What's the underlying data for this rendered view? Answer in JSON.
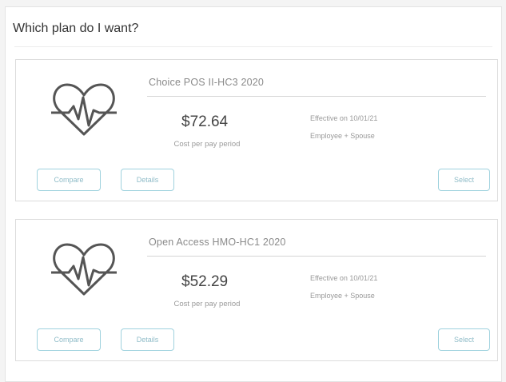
{
  "page": {
    "title": "Which plan do I want?"
  },
  "plans": [
    {
      "name": "Choice POS II-HC3 2020",
      "price": "$72.64",
      "price_caption": "Cost per pay period",
      "effective": "Effective on 10/01/21",
      "coverage": "Employee + Spouse",
      "icon": "heart-pulse-icon",
      "buttons": {
        "compare": "Compare",
        "details": "Details",
        "select": "Select"
      }
    },
    {
      "name": "Open Access HMO-HC1 2020",
      "price": "$52.29",
      "price_caption": "Cost per pay period",
      "effective": "Effective on 10/01/21",
      "coverage": "Employee + Spouse",
      "icon": "heart-pulse-icon",
      "buttons": {
        "compare": "Compare",
        "details": "Details",
        "select": "Select"
      }
    }
  ],
  "colors": {
    "button_border": "#9fd2de",
    "button_text": "#8fbcc8",
    "icon_stroke": "#555555"
  }
}
